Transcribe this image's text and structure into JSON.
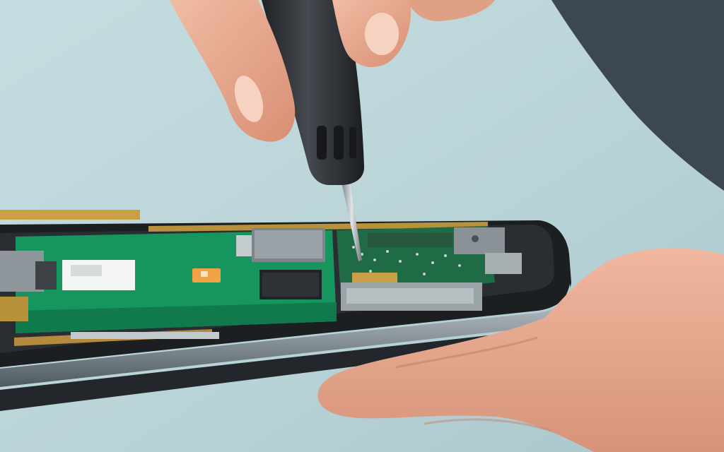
{
  "scene": {
    "subject": "phone-repair-photo",
    "colors": {
      "background": "#bcd6d9",
      "board": "#14935f",
      "skin": "#e8a98f",
      "tool": "#2c2f33",
      "frame": "#7f8a92"
    }
  }
}
